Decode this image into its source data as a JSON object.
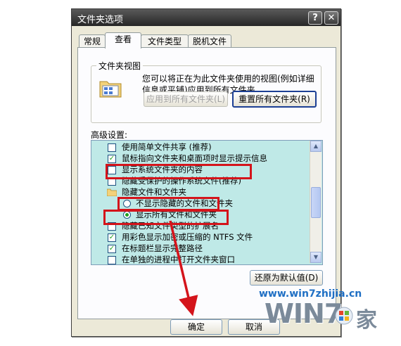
{
  "dialog": {
    "title": "文件夹选项",
    "help_btn": "?",
    "close_btn": "✕"
  },
  "tabs": [
    "常规",
    "查看",
    "文件类型",
    "脱机文件"
  ],
  "folder_views": {
    "label": "文件夹视图",
    "description": "您可以将正在为此文件夹使用的视图(例如详细信息或平铺)应用到所有文件夹。",
    "apply_all": "应用到所有文件夹(L)",
    "reset_all": "重置所有文件夹(R)"
  },
  "advanced": {
    "label": "高级设置:",
    "items": [
      {
        "type": "checkbox",
        "checked": false,
        "text": "使用简单文件共享 (推荐)"
      },
      {
        "type": "checkbox",
        "checked": true,
        "text": "鼠标指向文件夹和桌面项时显示提示信息"
      },
      {
        "type": "checkbox",
        "checked": false,
        "text": "显示系统文件夹的内容"
      },
      {
        "type": "checkbox",
        "checked": false,
        "text": "隐藏受保护的操作系统文件(推荐)"
      },
      {
        "type": "folder",
        "text": "隐藏文件和文件夹"
      },
      {
        "type": "radio",
        "checked": false,
        "text": "不显示隐藏的文件和文件夹"
      },
      {
        "type": "radio",
        "checked": true,
        "text": "显示所有文件和文件夹"
      },
      {
        "type": "checkbox",
        "checked": false,
        "text": "隐藏已知文件类型的扩展名"
      },
      {
        "type": "checkbox",
        "checked": true,
        "text": "用彩色显示加密或压缩的 NTFS 文件"
      },
      {
        "type": "checkbox",
        "checked": true,
        "text": "在标题栏显示完整路径"
      },
      {
        "type": "checkbox",
        "checked": false,
        "text": "在单独的进程中打开文件夹窗口"
      }
    ],
    "restore_defaults": "还原为默认值(D)"
  },
  "footer": {
    "ok": "确定",
    "cancel": "取消"
  },
  "watermark": {
    "url": "www.win7zhijia.cn",
    "logo": "WIN7",
    "home": "家"
  },
  "colors": {
    "highlight": "#d4141b",
    "list_bg": "#bfe9e7"
  }
}
